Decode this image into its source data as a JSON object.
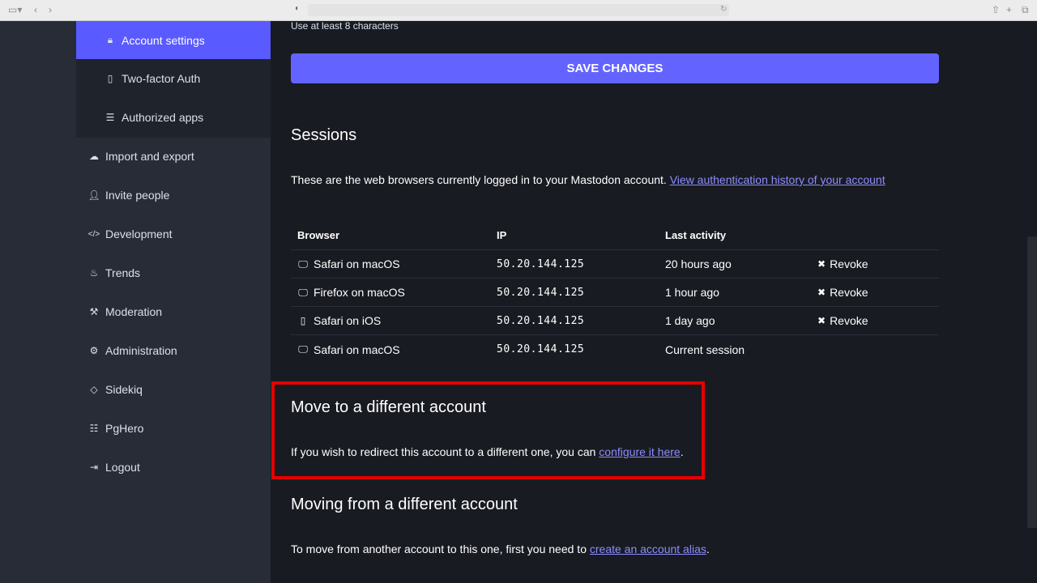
{
  "sidebar": {
    "active_item": {
      "label": "Account settings",
      "icon": "lock-icon"
    },
    "sub_items": [
      {
        "label": "Two-factor Auth",
        "icon": "mobile-icon"
      },
      {
        "label": "Authorized apps",
        "icon": "list-icon"
      }
    ],
    "items": [
      {
        "label": "Import and export",
        "icon": "cloud-icon"
      },
      {
        "label": "Invite people",
        "icon": "user-plus-icon"
      },
      {
        "label": "Development",
        "icon": "code-icon"
      },
      {
        "label": "Trends",
        "icon": "fire-icon"
      },
      {
        "label": "Moderation",
        "icon": "gavel-icon"
      },
      {
        "label": "Administration",
        "icon": "cogs-icon"
      },
      {
        "label": "Sidekiq",
        "icon": "diamond-icon"
      },
      {
        "label": "PgHero",
        "icon": "database-icon"
      },
      {
        "label": "Logout",
        "icon": "sign-out-icon"
      }
    ]
  },
  "password_hint": "Use at least 8 characters",
  "save_button": "SAVE CHANGES",
  "sessions": {
    "title": "Sessions",
    "description": "These are the web browsers currently logged in to your Mastodon account.",
    "history_link": "View authentication history of your account",
    "headers": [
      "Browser",
      "IP",
      "Last activity",
      ""
    ],
    "rows": [
      {
        "browser": "Safari on macOS",
        "device": "desktop",
        "ip": "50.20.144.125",
        "activity": "20 hours ago",
        "action": "Revoke"
      },
      {
        "browser": "Firefox on macOS",
        "device": "desktop",
        "ip": "50.20.144.125",
        "activity": "1 hour ago",
        "action": "Revoke"
      },
      {
        "browser": "Safari on iOS",
        "device": "mobile",
        "ip": "50.20.144.125",
        "activity": "1 day ago",
        "action": "Revoke"
      },
      {
        "browser": "Safari on macOS",
        "device": "desktop",
        "ip": "50.20.144.125",
        "activity": "Current session",
        "action": ""
      }
    ]
  },
  "move_to": {
    "title": "Move to a different account",
    "text": "If you wish to redirect this account to a different one, you can",
    "link": "configure it here",
    "suffix": "."
  },
  "move_from": {
    "title": "Moving from a different account",
    "text": "To move from another account to this one, first you need to",
    "link": "create an account alias",
    "suffix": "."
  },
  "colors": {
    "accent": "#6364ff",
    "link": "#8c8dff",
    "highlight": "#e60000",
    "sidebar_bg": "#282c37",
    "content_bg": "#191b22"
  }
}
